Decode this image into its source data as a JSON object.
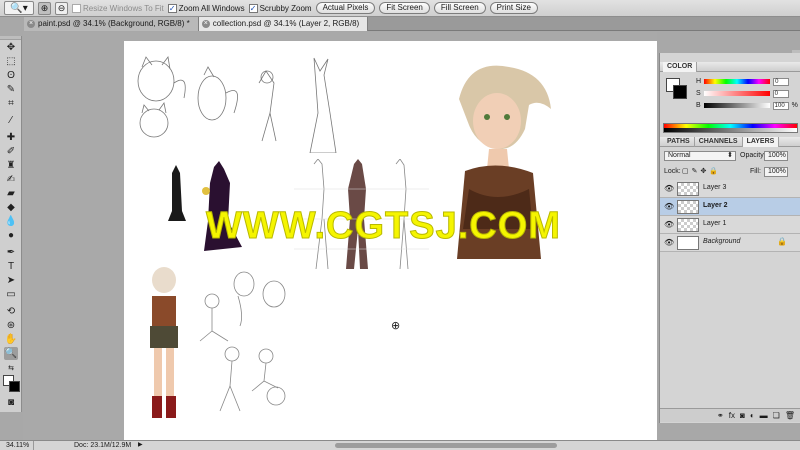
{
  "options_bar": {
    "tool_preset_icon": "zoom-icon",
    "zoom_in_label": "⊕",
    "zoom_out_label": "⊖",
    "resize_windows_label": "Resize Windows To Fit",
    "zoom_all_windows_label": "Zoom All Windows",
    "scrubby_zoom_label": "Scrubby Zoom",
    "actual_pixels_label": "Actual Pixels",
    "fit_screen_label": "Fit Screen",
    "fill_screen_label": "Fill Screen",
    "print_size_label": "Print Size"
  },
  "tabs": [
    {
      "label": "paint.psd @ 34.1% (Background, RGB/8) *"
    },
    {
      "label": "collection.psd @ 34.1% (Layer 2, RGB/8)"
    }
  ],
  "canvas": {
    "watermark": "WWW.CGTSJ.COM"
  },
  "status": {
    "zoom": "34.11%",
    "doc": "Doc: 23.1M/12.9M"
  },
  "color_panel": {
    "title": "COLOR",
    "h_label": "H",
    "s_label": "S",
    "b_label": "B",
    "h_value": "0",
    "s_value": "0",
    "b_value": "100",
    "unit": "%"
  },
  "layers_panel": {
    "tabs": [
      "PATHS",
      "CHANNELS",
      "LAYERS"
    ],
    "blend_mode": "Normal",
    "opacity_label": "Opacity:",
    "opacity_value": "100%",
    "lock_label": "Lock:",
    "fill_label": "Fill:",
    "fill_value": "100%",
    "layers": [
      {
        "name": "Layer 3"
      },
      {
        "name": "Layer 2"
      },
      {
        "name": "Layer 1"
      },
      {
        "name": "Background"
      }
    ]
  }
}
